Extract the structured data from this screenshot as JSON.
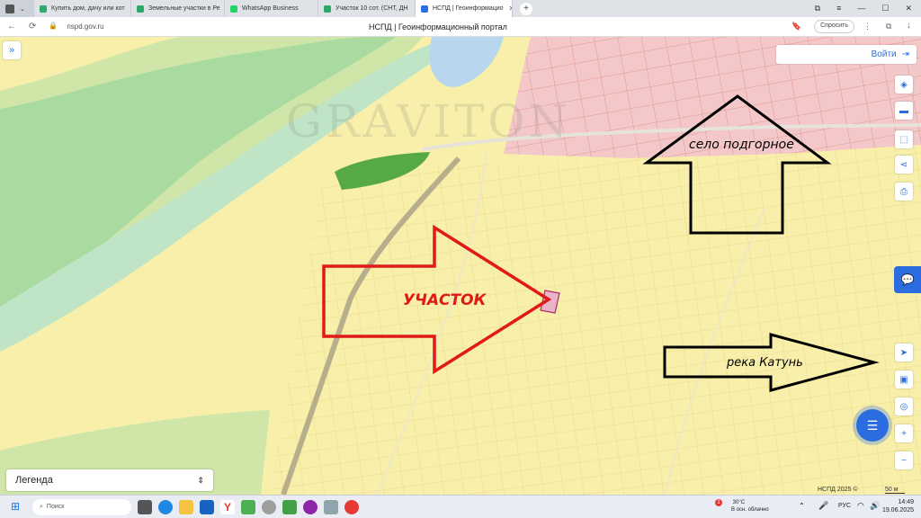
{
  "browser": {
    "tabs": [
      {
        "label": "Купить дом, дачу или кот",
        "color": "#2ea86b"
      },
      {
        "label": "Земельные участки в Ре",
        "color": "#2ea86b"
      },
      {
        "label": "WhatsApp Business",
        "color": "#25d366"
      },
      {
        "label": "Участок 10 сот. (СНТ, ДН",
        "color": "#2ea86b"
      },
      {
        "label": "НСПД | Геоинформацио",
        "color": "#2b6de0"
      }
    ],
    "new_tab": "+",
    "url": "nspd.gov.ru",
    "page_title": "НСПД | Геоинформационный портал",
    "ask_label": "Спросить"
  },
  "map": {
    "login_label": "Войти",
    "legend_label": "Легенда",
    "copyright": "НСПД 2025 ©",
    "scale_label": "50 м",
    "watermark": "GRAVITON",
    "annotations": {
      "plot": "УЧАСТОК",
      "village": "село подгорное",
      "river": "река Катунь"
    }
  },
  "taskbar": {
    "search_placeholder": "Поиск",
    "temperature": "30°C",
    "weather": "В осн. облачно",
    "weather_badge": "1",
    "lang": "РУС",
    "time": "14:49",
    "date": "19.06.2025"
  }
}
